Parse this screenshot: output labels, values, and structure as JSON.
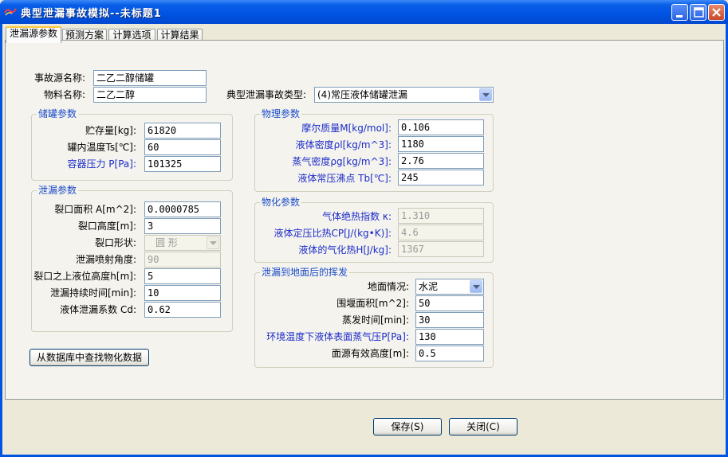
{
  "window": {
    "title": "典型泄漏事故模拟--未标题1",
    "controls": [
      "minimize-icon",
      "maximize-icon",
      "close-icon"
    ]
  },
  "tabs": [
    {
      "label": "泄漏源参数",
      "active": true
    },
    {
      "label": "预测方案",
      "active": false
    },
    {
      "label": "计算选项",
      "active": false
    },
    {
      "label": "计算结果",
      "active": false
    }
  ],
  "header": {
    "source_name_label": "事故源名称:",
    "source_name_value": "二乙二醇储罐",
    "material_label": "物料名称:",
    "material_value": "二乙二醇",
    "accident_type_label": "典型泄漏事故类型:",
    "accident_type_value": "(4)常压液体储罐泄漏"
  },
  "tank": {
    "title": "储罐参数",
    "rows": [
      {
        "label": "贮存量[kg]:",
        "value": "61820"
      },
      {
        "label": "罐内温度Ts[℃]:",
        "value": "60"
      },
      {
        "label": "容器压力 P[Pa]:",
        "value": "101325"
      }
    ]
  },
  "leak": {
    "title": "泄漏参数",
    "area_label": "裂口面积 A[m^2]:",
    "area_value": "0.0000785",
    "height_label": "裂口高度[m]:",
    "height_value": "3",
    "shape_label": "裂口形状:",
    "shape_value": "圆  形",
    "angle_label": "泄漏喷射角度:",
    "angle_value": "90",
    "liquid_height_label": "裂口之上液位高度h[m]:",
    "liquid_height_value": "5",
    "duration_label": "泄漏持续时间[min]:",
    "duration_value": "10",
    "coef_label": "液体泄漏系数  Cd:",
    "coef_value": "0.62"
  },
  "physical": {
    "title": "物理参数",
    "rows": [
      {
        "label": "摩尔质量M[kg/mol]:",
        "value": "0.106"
      },
      {
        "label": "液体密度ρl[kg/m^3]:",
        "value": "1180"
      },
      {
        "label": "蒸气密度ρg[kg/m^3]:",
        "value": "2.76"
      },
      {
        "label": "液体常压沸点 Tb[℃]:",
        "value": "245"
      }
    ]
  },
  "physchem": {
    "title": "物化参数",
    "rows": [
      {
        "label": "气体绝热指数  κ:",
        "value": "1.310"
      },
      {
        "label": "液体定压比热CP[J/(kg•K)]:",
        "value": "4.6"
      },
      {
        "label": "液体的气化热H[J/kg]:",
        "value": "1367"
      }
    ]
  },
  "evap": {
    "title": "泄漏到地面后的挥发",
    "ground_label": "地面情况:",
    "ground_value": "水泥",
    "dike_label": "围堰面积[m^2]:",
    "dike_value": "50",
    "time_label": "蒸发时间[min]:",
    "time_value": "30",
    "vp_label": "环境温度下液体表面蒸气压P[Pa]:",
    "vp_value": "130",
    "height_label": "面源有效高度[m]:",
    "height_value": "0.5"
  },
  "buttons": {
    "lookup": "从数据库中查找物化数据",
    "save": "保存(S)",
    "close": "关闭(C)"
  },
  "colors": {
    "titlebar": "#0054e3",
    "label_blue": "#1c2cc8",
    "group_title": "#1c4cc8"
  }
}
